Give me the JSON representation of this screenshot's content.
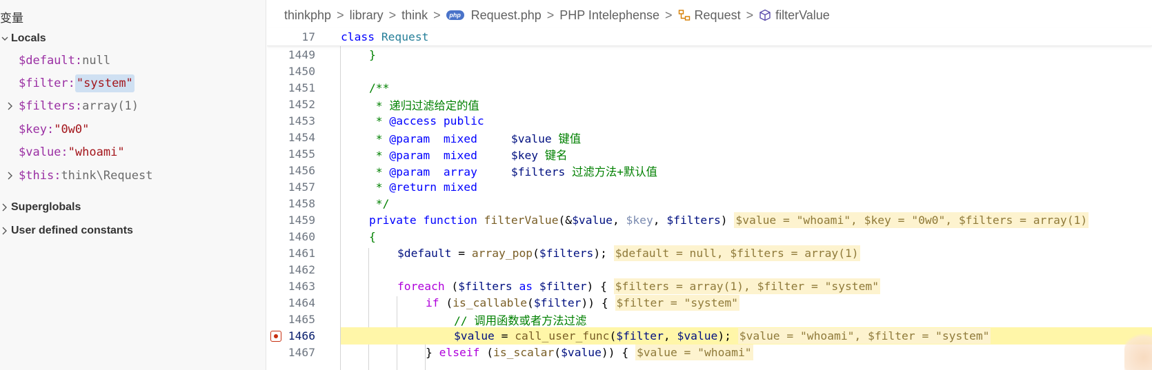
{
  "sidebar": {
    "title": "变量",
    "locals_label": "Locals",
    "variables": [
      {
        "name": "$default",
        "sep": ": ",
        "value": "null",
        "kind": "type",
        "expandable": false
      },
      {
        "name": "$filter",
        "sep": ": ",
        "value": "\"system\"",
        "kind": "string",
        "expandable": false,
        "highlighted": true
      },
      {
        "name": "$filters",
        "sep": ": ",
        "value": "array(1)",
        "kind": "type",
        "expandable": true
      },
      {
        "name": "$key",
        "sep": ": ",
        "value": "\"0w0\"",
        "kind": "string",
        "expandable": false
      },
      {
        "name": "$value",
        "sep": ": ",
        "value": "\"whoami\"",
        "kind": "string",
        "expandable": false
      },
      {
        "name": "$this",
        "sep": ": ",
        "value": "think\\Request",
        "kind": "type",
        "expandable": true
      }
    ],
    "superglobals_label": "Superglobals",
    "constants_label": "User defined constants"
  },
  "breadcrumb": {
    "items": [
      "thinkphp",
      "library",
      "think",
      "Request.php",
      "PHP Intelephense",
      "Request",
      "filterValue"
    ],
    "php_badge": "php",
    "separator": ">"
  },
  "editor": {
    "sticky": {
      "line": "17",
      "kw": "class",
      "name": "Request"
    },
    "lines": [
      {
        "n": "1449",
        "t": "}"
      },
      {
        "n": "1450",
        "t": ""
      },
      {
        "n": "1451",
        "t": "/**"
      },
      {
        "n": "1452",
        "t": " * 递归过滤给定的值"
      },
      {
        "n": "1453",
        "t": " * @access public"
      },
      {
        "n": "1454",
        "t": " * @param  mixed     $value 键值"
      },
      {
        "n": "1455",
        "t": " * @param  mixed     $key 键名"
      },
      {
        "n": "1456",
        "t": " * @param  array     $filters 过滤方法+默认值"
      },
      {
        "n": "1457",
        "t": " * @return mixed"
      },
      {
        "n": "1458",
        "t": " */"
      },
      {
        "n": "1459",
        "t": "private function filterValue(&$value, $key, $filters)"
      },
      {
        "n": "1460",
        "t": "{"
      },
      {
        "n": "1461",
        "t": "$default = array_pop($filters);"
      },
      {
        "n": "1462",
        "t": ""
      },
      {
        "n": "1463",
        "t": "foreach ($filters as $filter) {"
      },
      {
        "n": "1464",
        "t": "if (is_callable($filter)) {"
      },
      {
        "n": "1465",
        "t": "// 调用函数或者方法过滤"
      },
      {
        "n": "1466",
        "t": "$value = call_user_func($filter, $value);"
      },
      {
        "n": "1467",
        "t": "} elseif (is_scalar($value)) {"
      }
    ],
    "inline_values": {
      "l1459": "$value = \"whoami\", $key = \"0w0\", $filters = array(1)",
      "l1461": "$default = null, $filters = array(1)",
      "l1463": "$filters = array(1), $filter = \"system\"",
      "l1464": "$filter = \"system\"",
      "l1466": "$value = \"whoami\", $filter = \"system\"",
      "l1467": "$value = \"whoami\""
    },
    "comment_text": {
      "c1452": "递归过滤给定的值",
      "c1454": "键值",
      "c1455": "键名",
      "c1456": "过滤方法+默认值",
      "c1465": "// 调用函数或者方法过滤"
    },
    "current_line": "1466"
  },
  "colors": {
    "current_line_bg": "#fff6a8",
    "inline_value_bg": "#fdf3cf",
    "breakpoint": "#c72e0f"
  }
}
